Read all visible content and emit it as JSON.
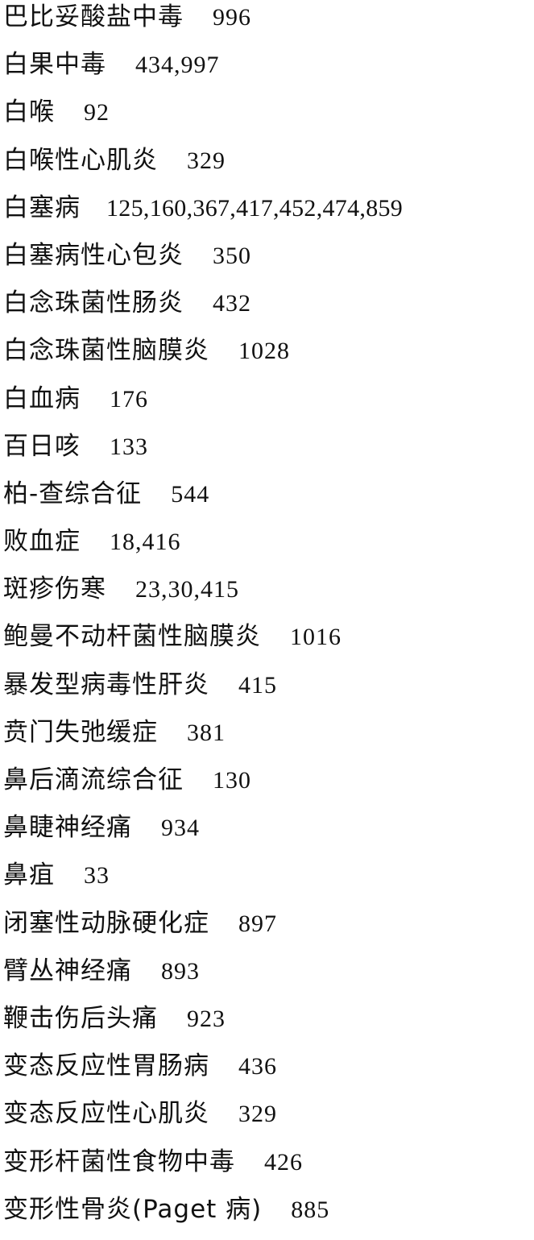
{
  "entries": [
    {
      "term": "巴比妥酸盐中毒",
      "pages": "996"
    },
    {
      "term": "白果中毒",
      "pages": "434,997"
    },
    {
      "term": "白喉",
      "pages": "92"
    },
    {
      "term": "白喉性心肌炎",
      "pages": "329"
    },
    {
      "term": "白塞病",
      "pages": "125,160,367,417,452,474,859"
    },
    {
      "term": "白塞病性心包炎",
      "pages": "350"
    },
    {
      "term": "白念珠菌性肠炎",
      "pages": "432"
    },
    {
      "term": "白念珠菌性脑膜炎",
      "pages": "1028"
    },
    {
      "term": "白血病",
      "pages": "176"
    },
    {
      "term": "百日咳",
      "pages": "133"
    },
    {
      "term": "柏-查综合征",
      "pages": "544"
    },
    {
      "term": "败血症",
      "pages": "18,416"
    },
    {
      "term": "斑疹伤寒",
      "pages": "23,30,415"
    },
    {
      "term": "鲍曼不动杆菌性脑膜炎",
      "pages": "1016"
    },
    {
      "term": "暴发型病毒性肝炎",
      "pages": "415"
    },
    {
      "term": "贲门失弛缓症",
      "pages": "381"
    },
    {
      "term": "鼻后滴流综合征",
      "pages": "130"
    },
    {
      "term": "鼻睫神经痛",
      "pages": "934"
    },
    {
      "term": "鼻疽",
      "pages": "33"
    },
    {
      "term": "闭塞性动脉硬化症",
      "pages": "897"
    },
    {
      "term": "臂丛神经痛",
      "pages": "893"
    },
    {
      "term": "鞭击伤后头痛",
      "pages": "923"
    },
    {
      "term": "变态反应性胃肠病",
      "pages": "436"
    },
    {
      "term": "变态反应性心肌炎",
      "pages": "329"
    },
    {
      "term": "变形杆菌性食物中毒",
      "pages": "426"
    },
    {
      "term": "变形性骨炎(Paget 病)",
      "pages": "885"
    }
  ]
}
